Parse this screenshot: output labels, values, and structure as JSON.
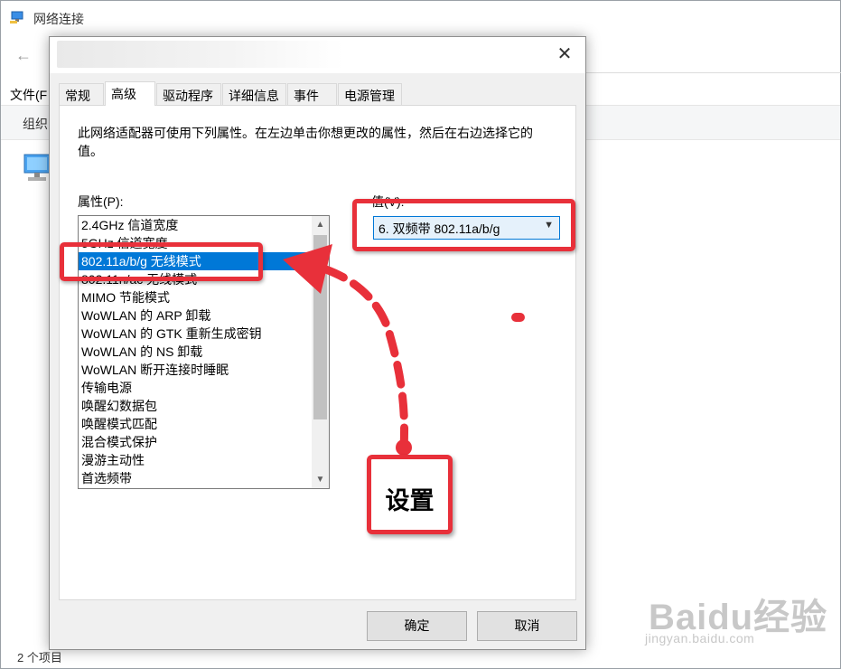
{
  "background_window": {
    "title": "网络连接",
    "menu_file": "文件(F",
    "cmd_organize": "组织",
    "status": "2 个项目"
  },
  "dialog": {
    "tabs": [
      {
        "label": "常规",
        "active": false
      },
      {
        "label": "高级",
        "active": true
      },
      {
        "label": "驱动程序",
        "active": false
      },
      {
        "label": "详细信息",
        "active": false
      },
      {
        "label": "事件",
        "active": false
      },
      {
        "label": "电源管理",
        "active": false
      }
    ],
    "description": "此网络适配器可使用下列属性。在左边单击你想更改的属性，然后在右边选择它的值。",
    "property_label": "属性(P):",
    "value_label": "值(V):",
    "properties": [
      "2.4GHz 信道宽度",
      "5GHz 信道宽度",
      "802.11a/b/g 无线模式",
      "802.11n/ac 无线模式",
      "MIMO 节能模式",
      "WoWLAN 的 ARP 卸载",
      "WoWLAN 的 GTK 重新生成密钥",
      "WoWLAN 的 NS 卸载",
      "WoWLAN 断开连接时睡眠",
      "传输电源",
      "唤醒幻数据包",
      "唤醒模式匹配",
      "混合模式保护",
      "漫游主动性",
      "首选频带"
    ],
    "selected_property_index": 2,
    "value": "6. 双频带 802.11a/b/g",
    "ok_label": "确定",
    "cancel_label": "取消"
  },
  "annotation": {
    "callout_text": "设置",
    "color": "#e8303a"
  },
  "watermark": {
    "text": "Baidu经验",
    "sub": "jingyan.baidu.com"
  },
  "colors": {
    "selection": "#0078d7",
    "annotation_red": "#e8303a"
  }
}
